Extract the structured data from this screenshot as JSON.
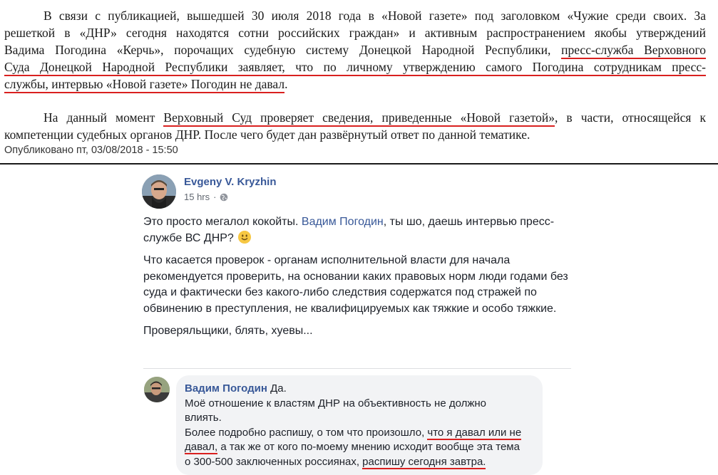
{
  "article": {
    "p1": [
      {
        "parts": [
          {
            "t": "В связи с публикацией, вышедшей 30 июля 2018 года  в «Новой газете» под заголовком «Чужие среди своих. За",
            "u": false
          }
        ],
        "indent": true
      },
      {
        "parts": [
          {
            "t": "решеткой в «ДНР» сегодня находятся сотни российских граждан» и активным распространением якобы утверждений",
            "u": false
          }
        ]
      },
      {
        "parts": [
          {
            "t": "Вадима Погодина «Керчь», порочащих судебную систему Донецкой Народной Республики, ",
            "u": false
          },
          {
            "t": "пресс-служба Верховного",
            "u": true
          }
        ]
      },
      {
        "parts": [
          {
            "t": "Суда Донецкой Народной Республики заявляет, что по личному утверждению самого Погодина сотрудникам пресс-",
            "u": true
          }
        ]
      },
      {
        "parts": [
          {
            "t": "службы, интервью «Новой газете» Погодин не давал",
            "u": true
          },
          {
            "t": ".",
            "u": false
          }
        ],
        "last": true
      }
    ],
    "p2": [
      {
        "parts": [
          {
            "t": "На данный момент ",
            "u": false
          },
          {
            "t": "Верховный Суд проверяет сведения, приведенные «Новой газетой»",
            "u": true
          },
          {
            "t": ", в части, относящейся к",
            "u": false
          }
        ],
        "indent": true
      },
      {
        "parts": [
          {
            "t": "компетенции судебных органов ДНР. После чего будет дан развёрнутый ответ по данной тематике.",
            "u": false
          }
        ],
        "last": true
      }
    ],
    "published": "Опубликовано пт, 03/08/2018 - 15:50"
  },
  "post": {
    "author": "Evgeny V. Kryzhin",
    "time": "15 hrs",
    "privacy_icon": "globe-icon",
    "p1_before": "Это просто мегалол кокойты. ",
    "p1_link": "Вадим Погодин",
    "p1_after": ", ты шо, даешь интервью пресс-службе ВС ДНР?",
    "emoji_icon": "smile-icon",
    "p2": "Что касается проверок - органам исполнительной власти для начала рекомендуется проверить, на основании каких правовых норм люди годами без суда и фактически без какого-либо следствия содержатся под стражей по обвинению в преступления, не квалифицируемых как тяжкие и особо тяжкие.",
    "p3": "Проверяльщики, блять, хуевы..."
  },
  "comment": {
    "author": "Вадим Погодин",
    "lines": [
      [
        {
          "t": " Да.",
          "u": false
        }
      ],
      [
        {
          "t": "Моё отношение к властям ДНР на объективность не должно",
          "u": false
        }
      ],
      [
        {
          "t": "влиять.",
          "u": false
        }
      ],
      [
        {
          "t": "Более подробно распишу, о том что произошло, ",
          "u": false
        },
        {
          "t": "что я давал или не",
          "u": true
        }
      ],
      [
        {
          "t": "давал,",
          "u": true
        },
        {
          "t": " а так же от кого по-моему мнению исходит вообще эта тема",
          "u": false
        }
      ],
      [
        {
          "t": "о 300-500 заключенных россиянах, ",
          "u": false
        },
        {
          "t": "распишу сегодня завтра.",
          "u": true
        }
      ]
    ]
  },
  "colors": {
    "underline": "#d9201f",
    "fb_blue": "#385898",
    "bubble": "#f2f3f5"
  }
}
